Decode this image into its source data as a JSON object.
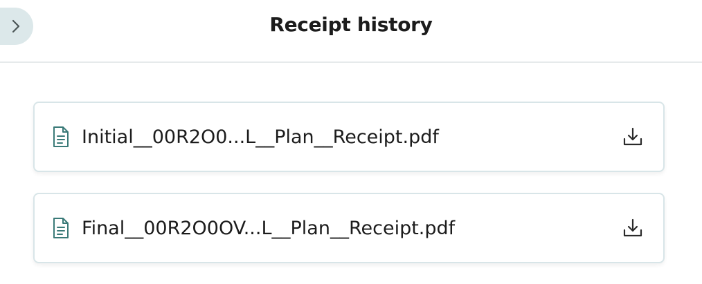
{
  "header": {
    "title": "Receipt history",
    "back_icon": "chevron-right-icon"
  },
  "receipts": [
    {
      "file_name": "Initial__00R2O0...L__Plan__Receipt.pdf",
      "icon": "document-icon",
      "action_icon": "download-icon"
    },
    {
      "file_name": "Final__00R2O0OV...L__Plan__Receipt.pdf",
      "icon": "document-icon",
      "action_icon": "download-icon"
    }
  ],
  "colors": {
    "accent": "#3a7a78",
    "card_border": "#d8e5e8",
    "back_button_bg": "#dce8ea"
  }
}
